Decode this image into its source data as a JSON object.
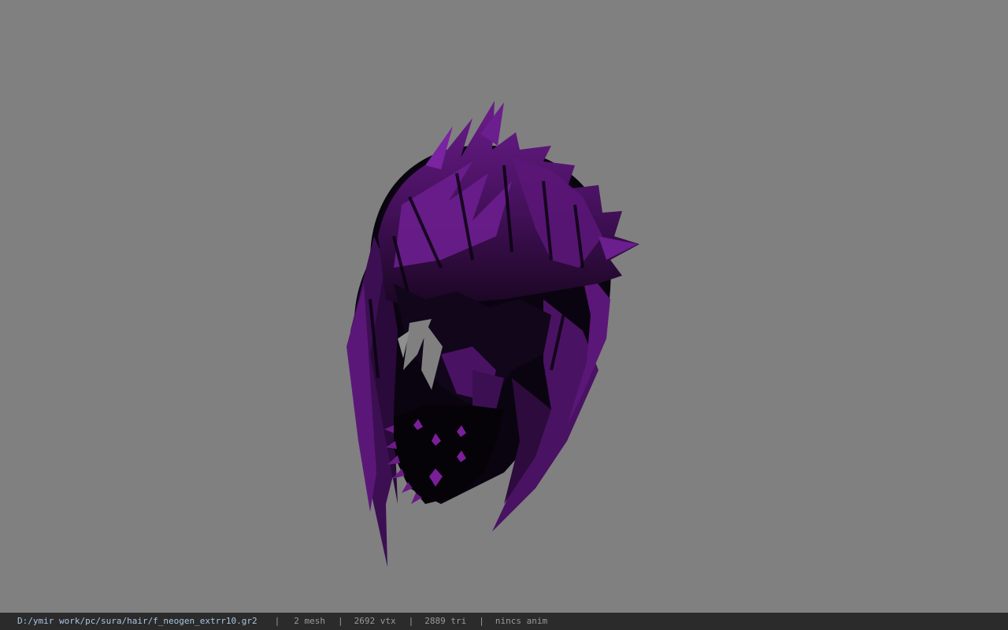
{
  "viewport": {
    "background_color": "#808080",
    "model": {
      "description_icon": "hair-model-3d",
      "colors": {
        "hair_purple": "#5b1777",
        "hair_dark": "#0a0410",
        "spike_purple": "#6b1b86"
      }
    }
  },
  "status_bar": {
    "path": "D:/ymir work/pc/sura/hair/f_neogen_extrr10.gr2",
    "separator": "|",
    "mesh": "2 mesh",
    "vtx": "2692 vtx",
    "tri": "2889 tri",
    "anim": "nincs anim",
    "colors": {
      "background": "#2b2b2b",
      "path_text": "#a8c6e2",
      "stat_text": "#9a9a9a"
    }
  }
}
